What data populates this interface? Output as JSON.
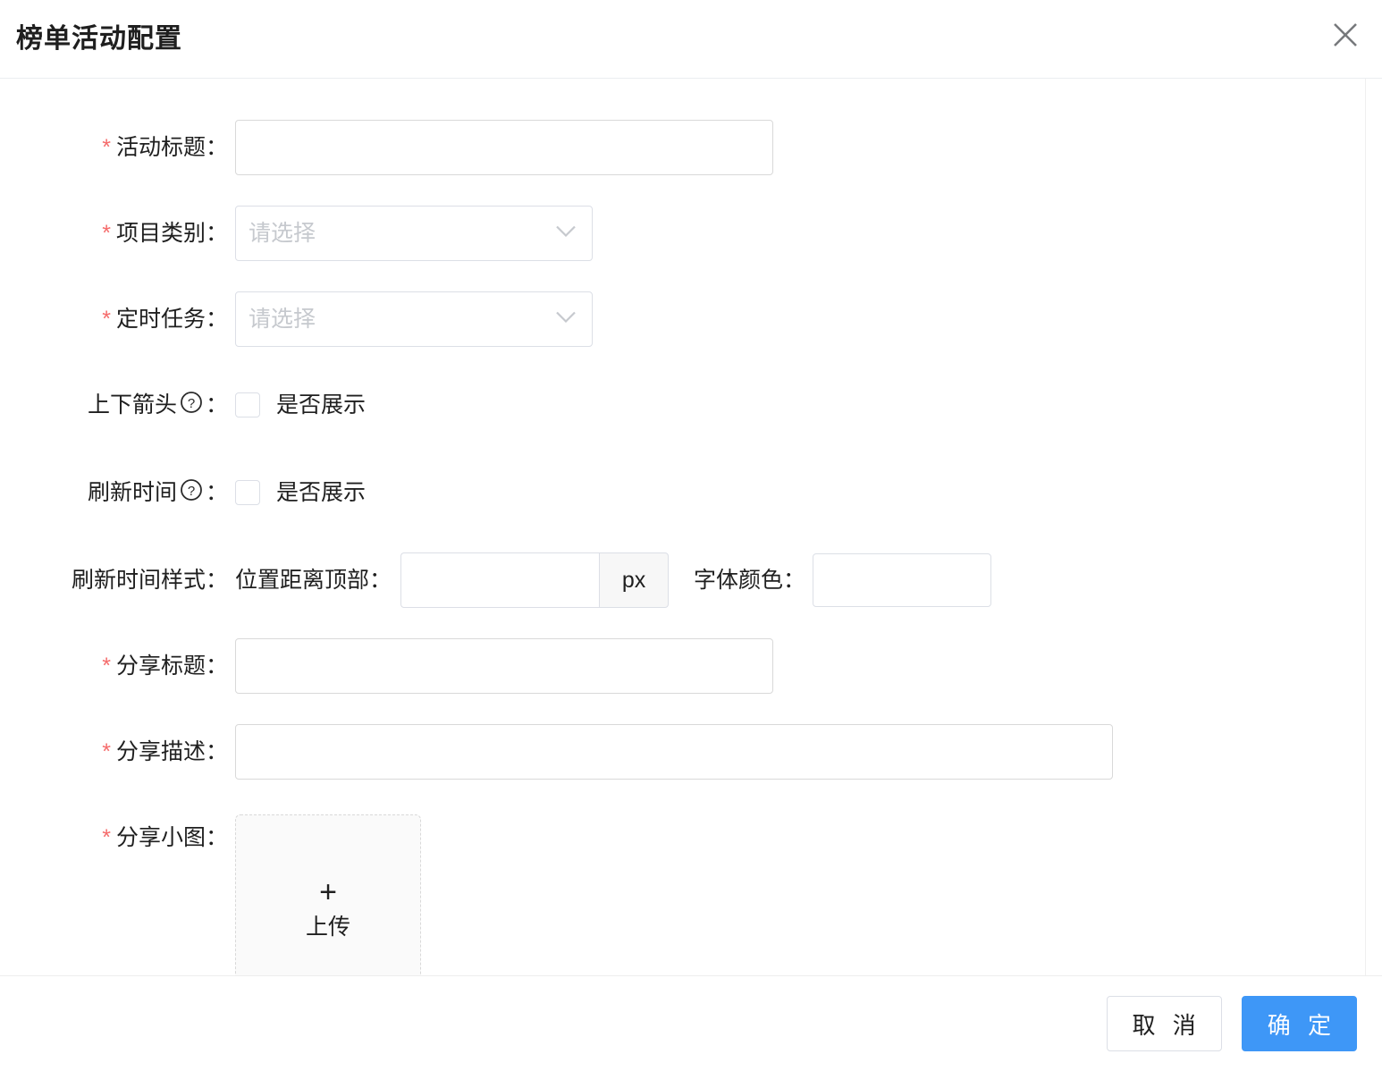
{
  "dialog": {
    "title": "榜单活动配置",
    "close_icon": "close-icon",
    "accent_color": "#3e97f7",
    "required_mark_color": "#f56c6c"
  },
  "form": {
    "required_mark": "*",
    "colon": "：",
    "rows": {
      "activity_title": {
        "label": "活动标题",
        "placeholder": "",
        "value": ""
      },
      "project_category": {
        "label": "项目类别",
        "placeholder": "请选择",
        "value": "",
        "chevron_icon": "chevron-down-icon"
      },
      "scheduled_task": {
        "label": "定时任务",
        "placeholder": "请选择",
        "value": "",
        "chevron_icon": "chevron-down-icon"
      },
      "arrow_toggle": {
        "label": "上下箭头",
        "help_icon": "question-circle-icon",
        "checkbox_label": "是否展示",
        "checked": false
      },
      "refresh_time_toggle": {
        "label": "刷新时间",
        "help_icon": "question-circle-icon",
        "checkbox_label": "是否展示",
        "checked": false
      },
      "refresh_time_style": {
        "label": "刷新时间样式",
        "top_offset_label": "位置距离顶部",
        "top_offset_value": "",
        "unit": "px",
        "font_color_label": "字体颜色",
        "font_color_value": ""
      },
      "share_title": {
        "label": "分享标题",
        "placeholder": "",
        "value": ""
      },
      "share_desc": {
        "label": "分享描述",
        "placeholder": "",
        "value": ""
      },
      "share_thumb": {
        "label": "分享小图",
        "plus_icon": "plus-icon",
        "upload_text": "上传"
      }
    }
  },
  "footer": {
    "cancel_label": "取 消",
    "confirm_label": "确 定"
  }
}
